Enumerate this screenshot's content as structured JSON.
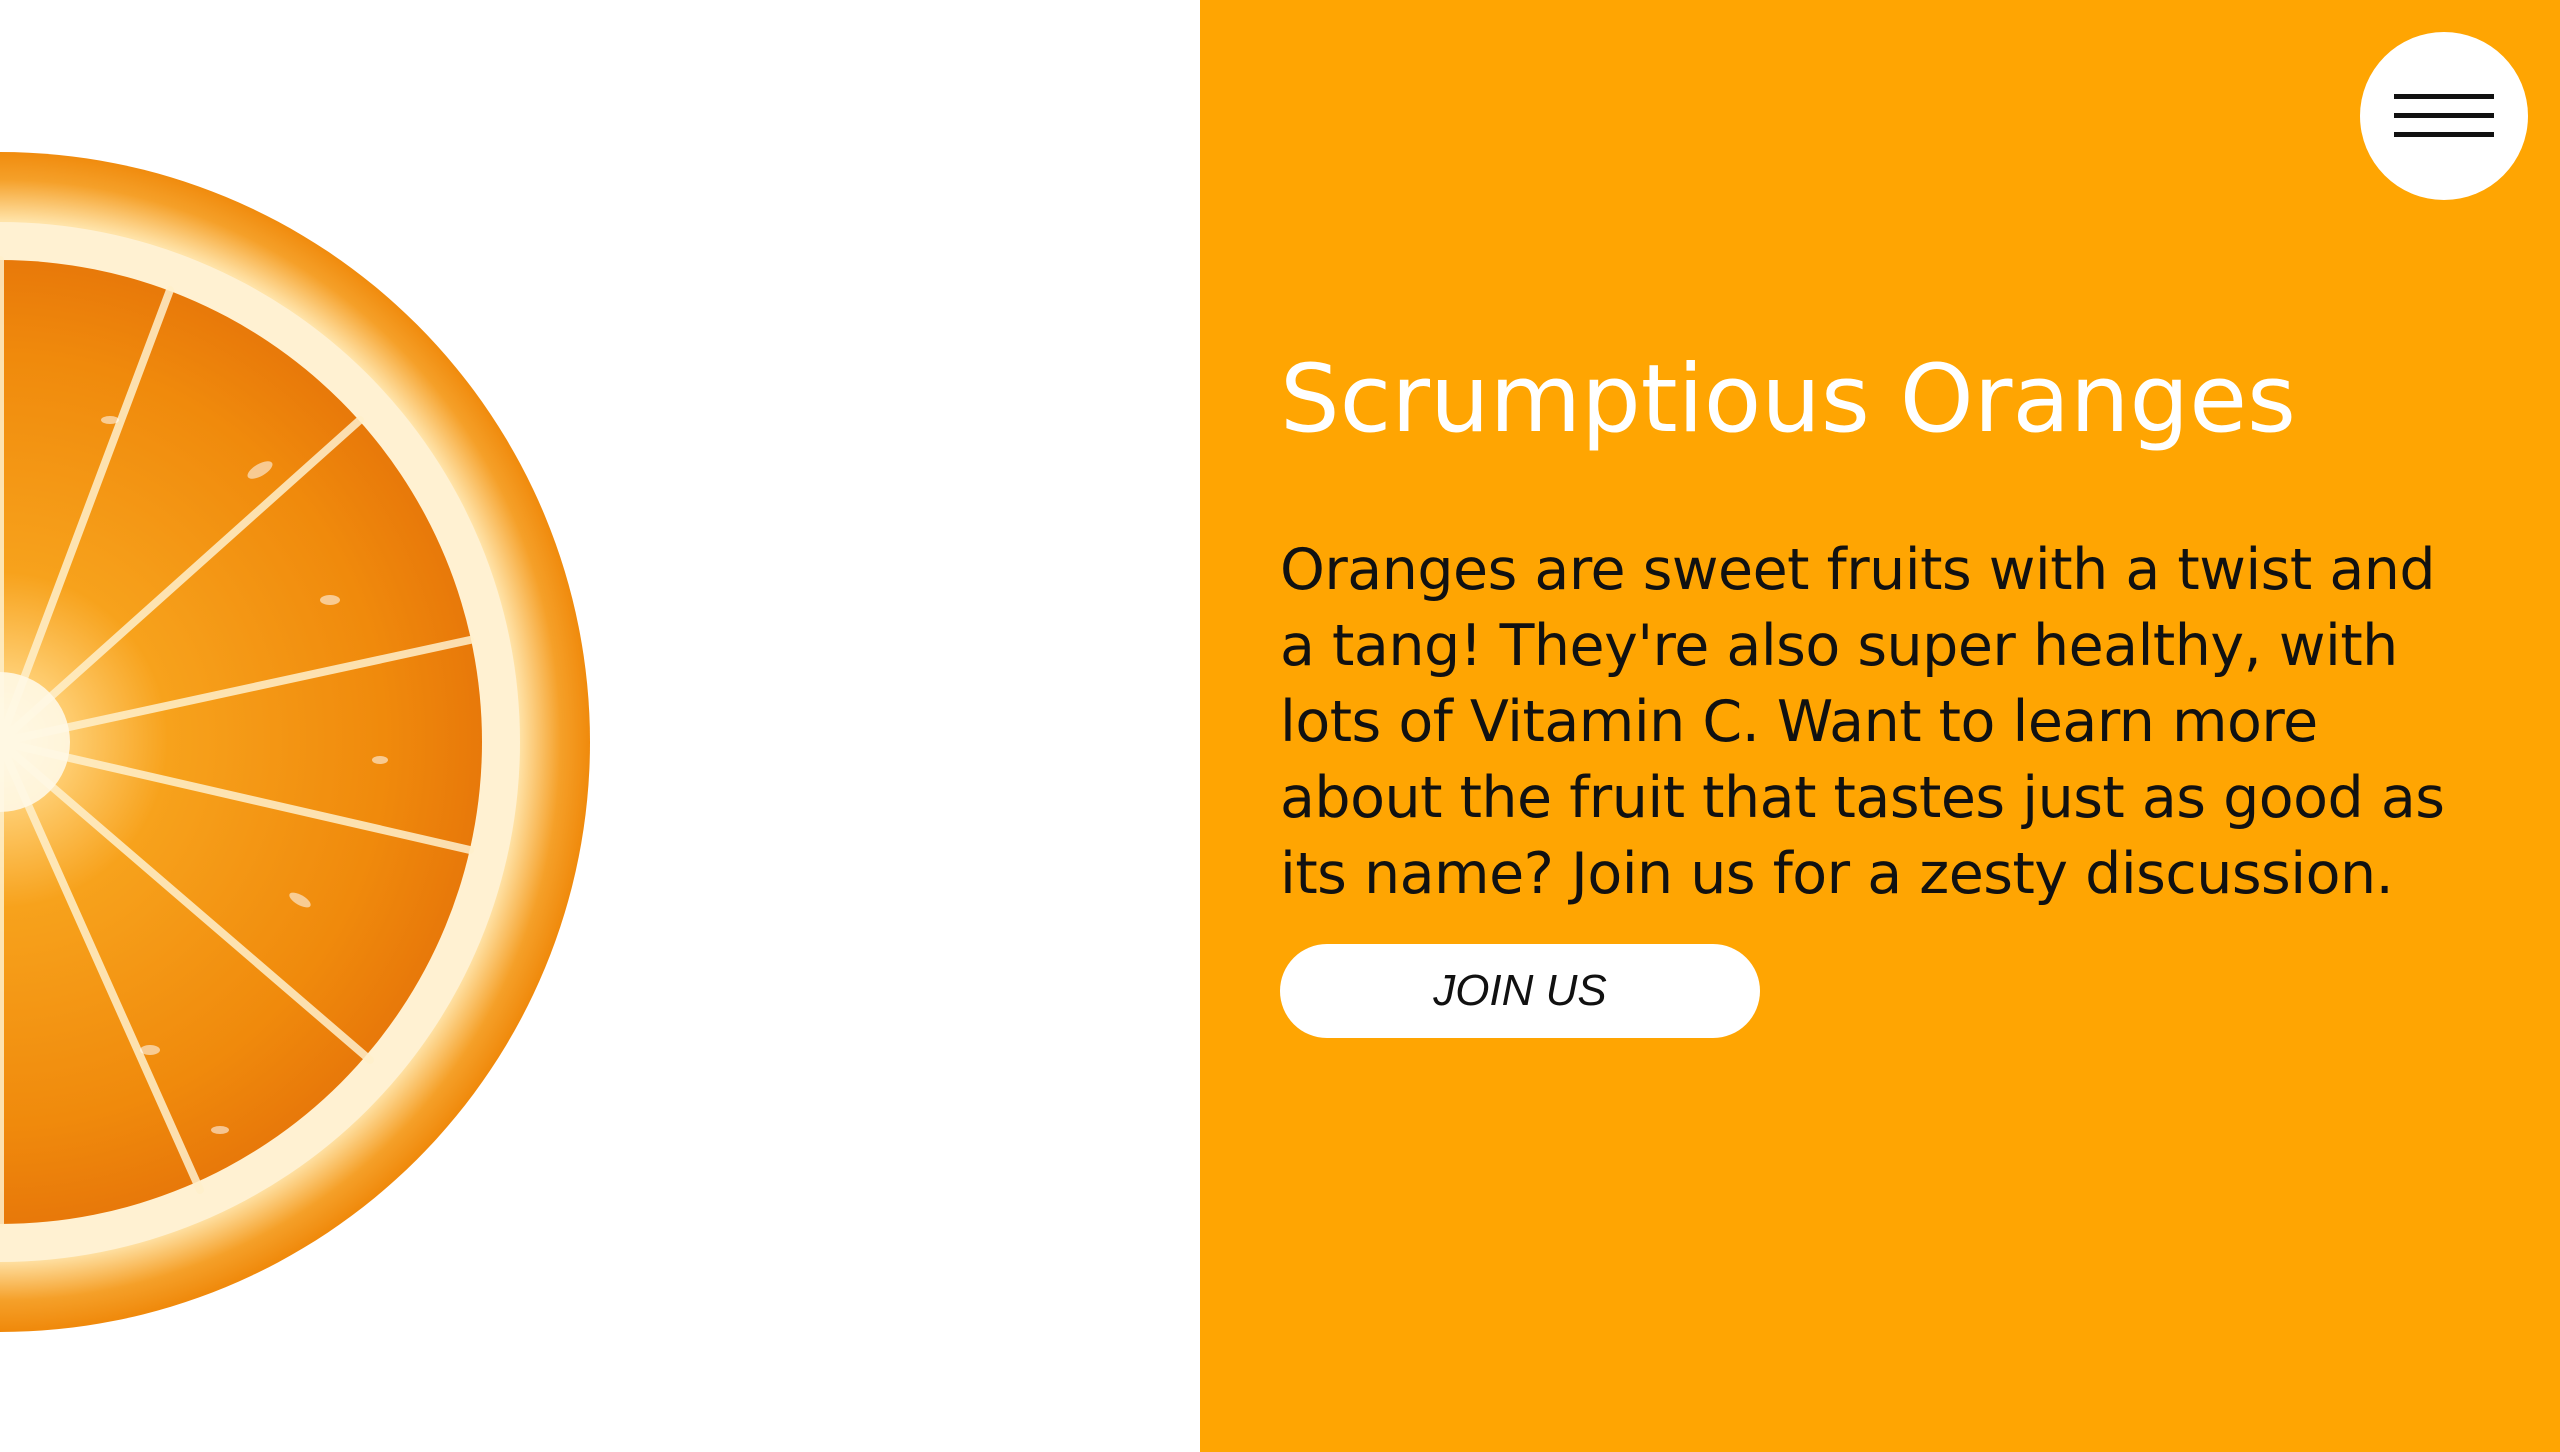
{
  "hero": {
    "title": "Scrumptious Oranges",
    "description": "Oranges are sweet fruits with a twist and a tang! They're also super healthy, with lots of Vitamin C. Want to learn more about the fruit that tastes just as good as its name? Join us for a zesty discussion.",
    "cta_label": "JOIN US"
  },
  "menu": {
    "icon": "hamburger-menu-icon"
  },
  "colors": {
    "accent_panel": "#ffa502",
    "title_text": "#ffffff",
    "body_text": "#111111",
    "button_background": "#ffffff"
  },
  "image": {
    "subject": "orange-slice"
  }
}
